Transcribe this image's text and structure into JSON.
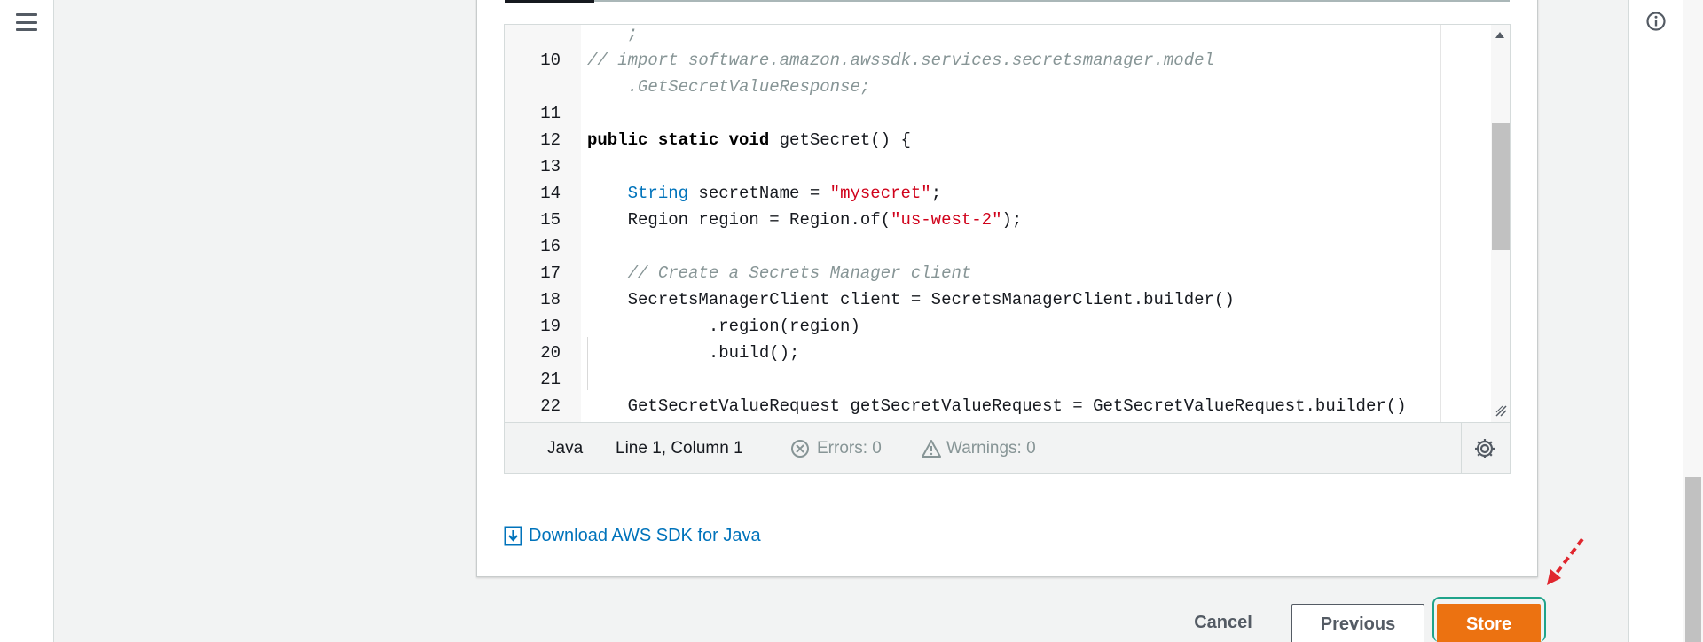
{
  "navigation": {
    "menu_icon": "hamburger-menu-icon",
    "info_icon": "info-icon"
  },
  "editor": {
    "lines": [
      {
        "number": "",
        "tokens": [
          {
            "t": "    ;",
            "k": "com"
          }
        ]
      },
      {
        "number": "10",
        "tokens": [
          {
            "t": "// import software.amazon.awssdk.services.secretsmanager.model",
            "k": "com"
          }
        ]
      },
      {
        "number": "",
        "tokens": [
          {
            "t": "    .GetSecretValueResponse;",
            "k": "com"
          }
        ]
      },
      {
        "number": "11",
        "tokens": []
      },
      {
        "number": "12",
        "tokens": [
          {
            "t": "public static void",
            "k": "kw"
          },
          {
            "t": " getSecret() {",
            "k": "plain"
          }
        ]
      },
      {
        "number": "13",
        "tokens": []
      },
      {
        "number": "14",
        "tokens": [
          {
            "t": "    ",
            "k": "plain"
          },
          {
            "t": "String",
            "k": "type"
          },
          {
            "t": " secretName = ",
            "k": "plain"
          },
          {
            "t": "\"mysecret\"",
            "k": "str"
          },
          {
            "t": ";",
            "k": "plain"
          }
        ]
      },
      {
        "number": "15",
        "tokens": [
          {
            "t": "    Region region = Region.of(",
            "k": "plain"
          },
          {
            "t": "\"us-west-2\"",
            "k": "str"
          },
          {
            "t": ");",
            "k": "plain"
          }
        ]
      },
      {
        "number": "16",
        "tokens": []
      },
      {
        "number": "17",
        "tokens": [
          {
            "t": "    // Create a Secrets Manager client",
            "k": "com"
          }
        ]
      },
      {
        "number": "18",
        "tokens": [
          {
            "t": "    SecretsManagerClient client = SecretsManagerClient.builder()",
            "k": "plain"
          }
        ]
      },
      {
        "number": "19",
        "tokens": [
          {
            "t": "            .region(region)",
            "k": "plain"
          }
        ]
      },
      {
        "number": "20",
        "tokens": [
          {
            "t": "            .build();",
            "k": "plain"
          }
        ]
      },
      {
        "number": "21",
        "tokens": []
      },
      {
        "number": "22",
        "tokens": [
          {
            "t": "    GetSecretValueRequest getSecretValueRequest = GetSecretValueRequest.builder()",
            "k": "plain"
          }
        ]
      }
    ],
    "status": {
      "language": "Java",
      "position": "Line 1, Column 1",
      "errors": "Errors: 0",
      "warnings": "Warnings: 0"
    }
  },
  "download_link": "Download AWS SDK for Java",
  "footer": {
    "cancel_label": "Cancel",
    "previous_label": "Previous",
    "store_label": "Store"
  },
  "colors": {
    "accent_orange": "#ec7211",
    "link_blue": "#0073bb",
    "string_red": "#d0021b",
    "highlight_teal": "#1fa38a",
    "annotation_red": "#e0262e"
  }
}
